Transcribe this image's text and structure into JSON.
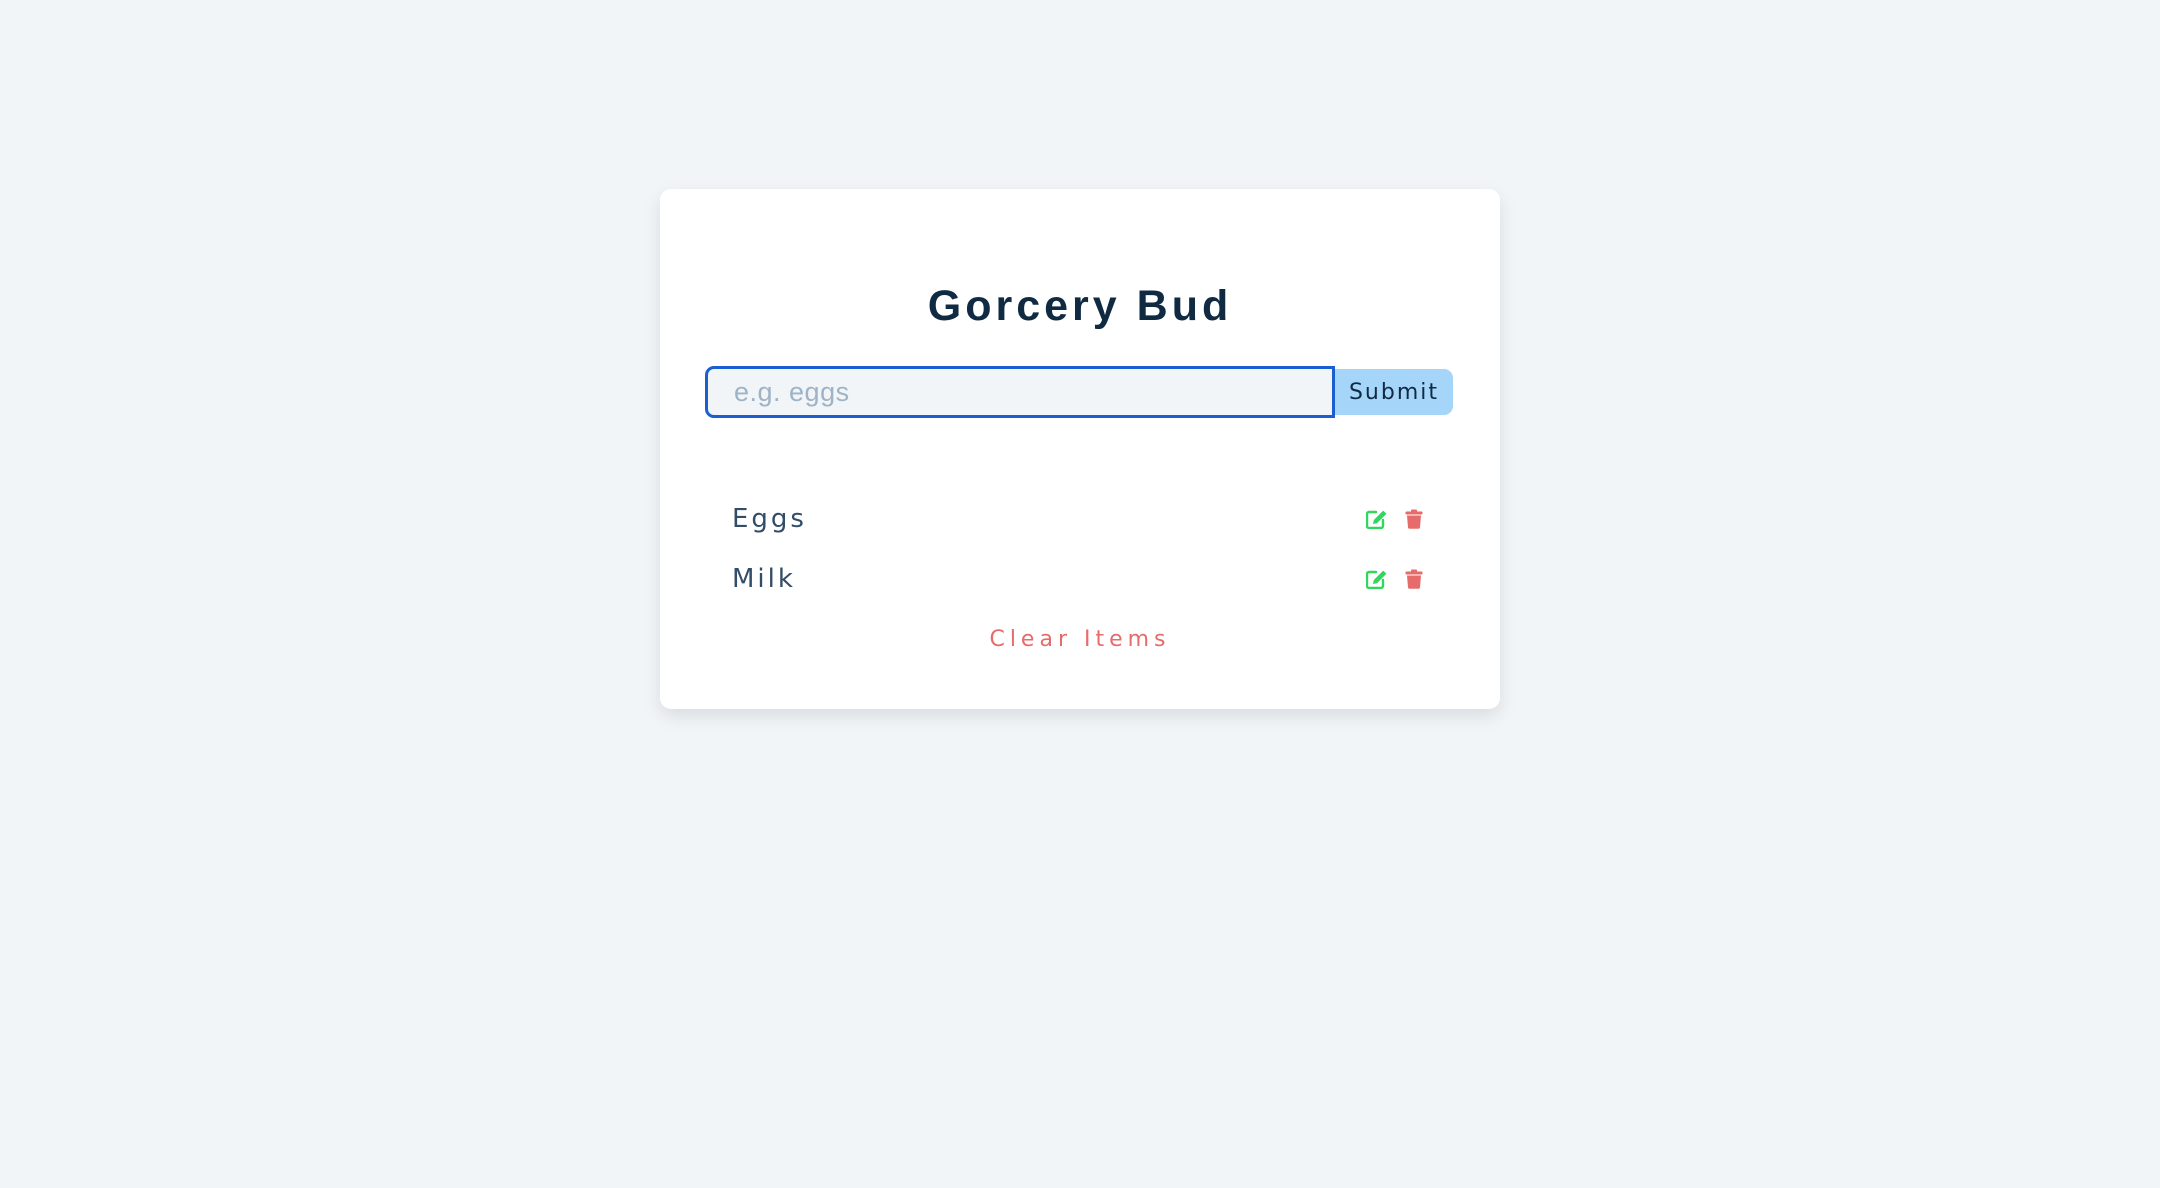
{
  "app": {
    "title": "Gorcery Bud"
  },
  "form": {
    "input_value": "",
    "input_placeholder": "e.g. eggs",
    "submit_label": "Submit"
  },
  "items": [
    {
      "name": "Eggs",
      "edit_icon": "edit-icon",
      "delete_icon": "trash-icon"
    },
    {
      "name": "Milk",
      "edit_icon": "edit-icon",
      "delete_icon": "trash-icon"
    }
  ],
  "clear_label": "Clear Items",
  "colors": {
    "page_background": "#f1f5f8",
    "card_background": "#ffffff",
    "title": "#102a42",
    "input_border_focus": "#1a5fd0",
    "submit_background": "#a5d5f8",
    "edit_icon": "#2fd85c",
    "delete_icon": "#e66b6b",
    "clear_text": "#e66b6b"
  }
}
